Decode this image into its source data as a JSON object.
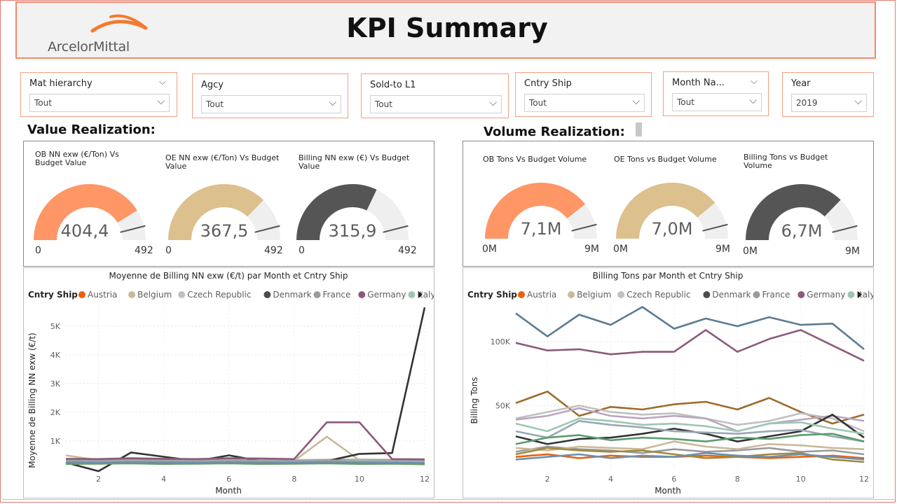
{
  "header": {
    "logo_text": "ArcelorMittal",
    "title": "KPI Summary"
  },
  "slicers": [
    {
      "label": "Mat hierarchy",
      "value": "Tout"
    },
    {
      "label": "Agcy",
      "value": "Tout"
    },
    {
      "label": "Sold-to L1",
      "value": "Tout"
    },
    {
      "label": "Cntry Ship",
      "value": "Tout"
    },
    {
      "label": "Month Na...",
      "value": "Tout"
    },
    {
      "label": "Year",
      "value": "2019"
    }
  ],
  "sections": {
    "value_title": "Value Realization:",
    "volume_title": "Volume Realization:"
  },
  "gauges": [
    {
      "title": "OB NN exw (€/Ton) Vs Budget Value",
      "value": 404.4,
      "value_label": "404,4",
      "min_label": "0",
      "max_label": "492",
      "target": 0.92,
      "color": "#fe9666"
    },
    {
      "title": "OE NN exw (€/Ton) Vs Budget Value",
      "value": 367.5,
      "value_label": "367,5",
      "min_label": "0",
      "max_label": "492",
      "target": 0.92,
      "color": "#dcc08d"
    },
    {
      "title": "Billing NN exw (€) Vs Budget Value",
      "value": 315.9,
      "value_label": "315,9",
      "min_label": "0",
      "max_label": "492",
      "target": 0.92,
      "color": "#555555"
    },
    {
      "title": "OB Tons Vs Budget Volume",
      "value": 7.1,
      "value_label": "7,1M",
      "min_label": "0M",
      "max_label": "9M",
      "target": 0.92,
      "color": "#fe9666"
    },
    {
      "title": "OE Tons vs Budget Volume",
      "value": 7.0,
      "value_label": "7,0M",
      "min_label": "0M",
      "max_label": "9M",
      "target": 0.92,
      "color": "#dcc08d"
    },
    {
      "title": "Billing Tons vs Budget Volume",
      "value": 6.7,
      "value_label": "6,7M",
      "min_label": "0M",
      "max_label": "9M",
      "target": 0.92,
      "color": "#555555"
    }
  ],
  "legend": {
    "title": "Cntry Ship",
    "items": [
      {
        "name": "Austria",
        "color": "#e8610c"
      },
      {
        "name": "Belgium",
        "color": "#c9b99a"
      },
      {
        "name": "Czech Republic",
        "color": "#c0c0c0"
      },
      {
        "name": "Denmark",
        "color": "#4d4d4d"
      },
      {
        "name": "France",
        "color": "#9a9a9a"
      },
      {
        "name": "Germany",
        "color": "#8b5a7a"
      },
      {
        "name": "Italy",
        "color": "#9ec7b3"
      }
    ],
    "more_icon": "triangle-right-icon"
  },
  "chart_data": [
    {
      "type": "line",
      "title": "Moyenne de Billing NN exw (€/t) par Month et Cntry Ship",
      "xlabel": "Month",
      "ylabel": "Moyenne de Billing NN exw (€/t)",
      "x": [
        1,
        2,
        3,
        4,
        5,
        6,
        7,
        8,
        9,
        10,
        11,
        12
      ],
      "x_ticks": [
        "2",
        "4",
        "6",
        "8",
        "10",
        "12"
      ],
      "y_ticks": [
        "1K",
        "2K",
        "3K",
        "4K",
        "5K"
      ],
      "ylim": [
        0,
        5800
      ],
      "xlim": [
        1,
        12
      ],
      "series": [
        {
          "name": "Austria",
          "color": "#e8610c",
          "values": [
            300,
            300,
            320,
            310,
            300,
            320,
            310,
            300,
            300,
            310,
            300,
            290
          ]
        },
        {
          "name": "Belgium",
          "color": "#c9b99a",
          "values": [
            500,
            330,
            340,
            320,
            330,
            340,
            320,
            310,
            1150,
            330,
            320,
            300
          ]
        },
        {
          "name": "Czech Republic",
          "color": "#c0c0c0",
          "values": [
            350,
            340,
            360,
            350,
            340,
            360,
            350,
            340,
            350,
            360,
            350,
            340
          ]
        },
        {
          "name": "Denmark",
          "color": "#333333",
          "values": [
            250,
            -50,
            600,
            450,
            300,
            500,
            300,
            250,
            300,
            550,
            580,
            5650
          ]
        },
        {
          "name": "France",
          "color": "#9a9a9a",
          "values": [
            330,
            320,
            340,
            330,
            320,
            330,
            320,
            310,
            330,
            320,
            330,
            310
          ]
        },
        {
          "name": "Germany",
          "color": "#8b5a7a",
          "values": [
            380,
            370,
            400,
            380,
            370,
            400,
            390,
            370,
            1650,
            1650,
            370,
            360
          ]
        },
        {
          "name": "Italy",
          "color": "#9ec7b3",
          "values": [
            280,
            270,
            290,
            280,
            270,
            290,
            280,
            270,
            280,
            290,
            280,
            270
          ]
        },
        {
          "values": [
            200,
            210,
            220,
            200,
            210,
            220,
            200,
            210,
            220,
            200,
            210,
            190
          ],
          "color": "#5d9c6e"
        },
        {
          "values": [
            240,
            230,
            250,
            240,
            230,
            250,
            240,
            230,
            250,
            240,
            230,
            220
          ],
          "color": "#a08a3c"
        },
        {
          "values": [
            260,
            250,
            270,
            260,
            250,
            270,
            260,
            250,
            270,
            260,
            250,
            240
          ],
          "color": "#6d8fb0"
        }
      ]
    },
    {
      "type": "line",
      "title": "Billing Tons par Month et Cntry Ship",
      "xlabel": "Month",
      "ylabel": "Billing Tons",
      "x": [
        1,
        2,
        3,
        4,
        5,
        6,
        7,
        8,
        9,
        10,
        11,
        12
      ],
      "x_ticks": [
        "2",
        "4",
        "6",
        "8",
        "10",
        "12"
      ],
      "y_ticks": [
        "50K",
        "100K"
      ],
      "ylim": [
        0,
        130000
      ],
      "xlim": [
        1,
        12
      ],
      "series": [
        {
          "values": [
            122000,
            104000,
            121000,
            113000,
            127000,
            110000,
            118000,
            112000,
            119000,
            113000,
            114000,
            94000
          ],
          "color": "#5b7b94"
        },
        {
          "name": "Germany",
          "color": "#8b5a7a",
          "values": [
            99000,
            93000,
            94000,
            90000,
            92000,
            92000,
            109000,
            92000,
            102000,
            109000,
            97000,
            85000
          ]
        },
        {
          "values": [
            52000,
            61000,
            42000,
            49000,
            47000,
            51000,
            53000,
            47000,
            56000,
            45000,
            36000,
            43000
          ],
          "color": "#9c6b2a"
        },
        {
          "name": "Czech Republic",
          "color": "#c0c0c0",
          "values": [
            40000,
            45000,
            50000,
            45000,
            43000,
            44000,
            40000,
            35000,
            38000,
            44000,
            40000,
            30000
          ]
        },
        {
          "values": [
            39000,
            42000,
            48000,
            42000,
            40000,
            42000,
            40000,
            30000,
            36000,
            39000,
            42000,
            38000
          ],
          "color": "#b8a7c0"
        },
        {
          "name": "Denmark",
          "color": "#333333",
          "values": [
            26000,
            20000,
            24000,
            25000,
            28000,
            32000,
            28000,
            22000,
            26000,
            30000,
            43000,
            25000
          ]
        },
        {
          "values": [
            30000,
            25000,
            38000,
            35000,
            33000,
            30000,
            29000,
            28000,
            30000,
            31000,
            26000,
            22000
          ],
          "color": "#9aa8b0"
        },
        {
          "name": "Italy",
          "color": "#9ec7b3",
          "values": [
            36000,
            30000,
            40000,
            38000,
            35000,
            36000,
            34000,
            30000,
            36000,
            37000,
            32000,
            28000
          ]
        },
        {
          "values": [
            20000,
            25000,
            27000,
            23000,
            25000,
            24000,
            22000,
            25000,
            24000,
            27000,
            28000,
            22000
          ],
          "color": "#5d9c6e"
        },
        {
          "name": "France",
          "color": "#9a9a9a",
          "values": [
            14000,
            18000,
            16000,
            15000,
            13000,
            16000,
            14000,
            15000,
            17000,
            14000,
            15000,
            12000
          ]
        },
        {
          "name": "Belgium",
          "color": "#c9b99a",
          "values": [
            17000,
            15000,
            18000,
            17000,
            16000,
            22000,
            18000,
            16000,
            20000,
            19000,
            17000,
            16000
          ]
        },
        {
          "name": "Austria",
          "color": "#e8610c",
          "values": [
            10000,
            12000,
            9000,
            11000,
            10000,
            10000,
            11000,
            10000,
            9000,
            10000,
            11000,
            9000
          ]
        },
        {
          "values": [
            12000,
            17000,
            15000,
            14000,
            15000,
            12000,
            9000,
            10000,
            12000,
            13000,
            8000,
            6000
          ],
          "color": "#a08a3c"
        },
        {
          "values": [
            8000,
            10000,
            12000,
            9000,
            11000,
            10000,
            13000,
            11000,
            10000,
            12000,
            10000,
            8000
          ],
          "color": "#6d8fb0"
        }
      ]
    }
  ]
}
